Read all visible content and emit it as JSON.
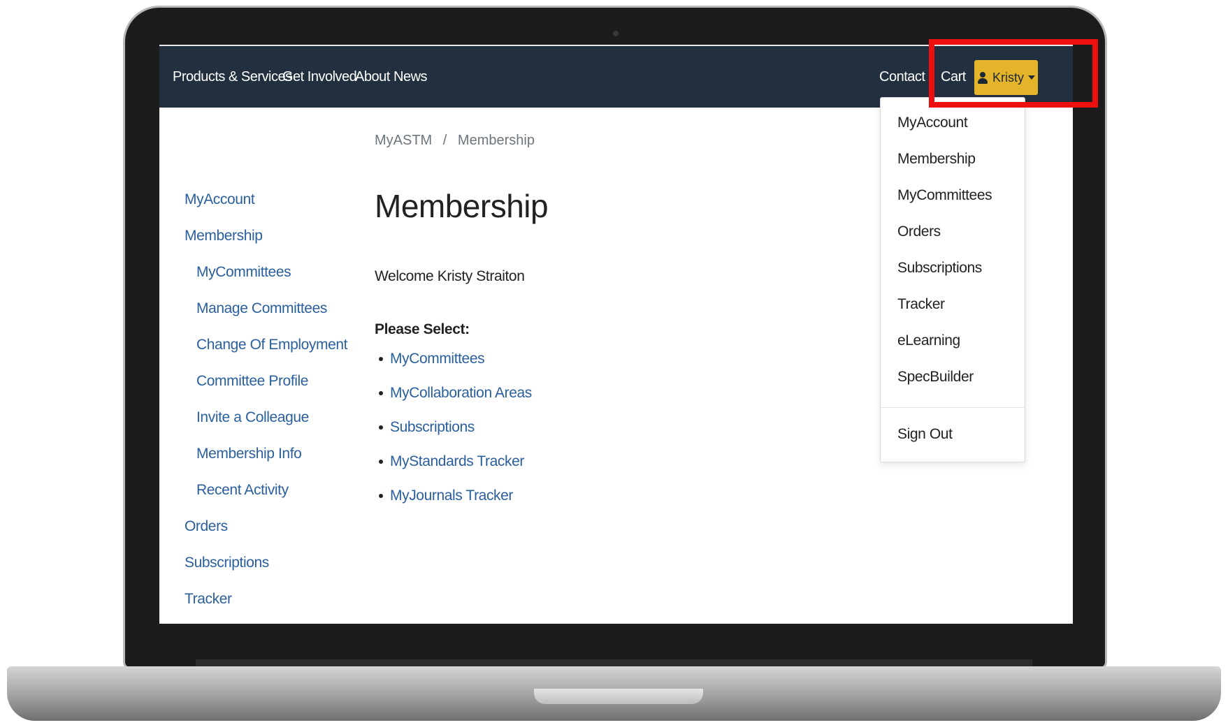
{
  "nav": {
    "products": "Products & Services",
    "get_involved": "Get Involved",
    "about": "About",
    "news": "News",
    "contact": "Contact",
    "cart": "Cart",
    "user_name": "Kristy"
  },
  "breadcrumb": {
    "root": "MyASTM",
    "separator": "/",
    "current": "Membership"
  },
  "sidebar": {
    "items": [
      {
        "label": "MyAccount",
        "level": 0
      },
      {
        "label": "Membership",
        "level": 0
      },
      {
        "label": "MyCommittees",
        "level": 1
      },
      {
        "label": "Manage Committees",
        "level": 1
      },
      {
        "label": "Change Of Employment",
        "level": 1
      },
      {
        "label": "Committee Profile",
        "level": 1
      },
      {
        "label": "Invite a Colleague",
        "level": 1
      },
      {
        "label": "Membership Info",
        "level": 1
      },
      {
        "label": "Recent Activity",
        "level": 1
      },
      {
        "label": "Orders",
        "level": 0
      },
      {
        "label": "Subscriptions",
        "level": 0
      },
      {
        "label": "Tracker",
        "level": 0
      }
    ]
  },
  "main": {
    "title": "Membership",
    "welcome": "Welcome Kristy Straiton",
    "please_select": "Please Select:",
    "options": [
      "MyCommittees",
      "MyCollaboration Areas",
      "Subscriptions",
      "MyStandards Tracker",
      "MyJournals Tracker"
    ]
  },
  "dropdown": {
    "items": [
      "MyAccount",
      "Membership",
      "MyCommittees",
      "Orders",
      "Subscriptions",
      "Tracker",
      "eLearning",
      "SpecBuilder"
    ],
    "sign_out": "Sign Out"
  },
  "colors": {
    "nav_bg": "#212f3e",
    "user_button": "#e4b42a",
    "link": "#2a5f9e",
    "highlight": "#ee1010"
  }
}
